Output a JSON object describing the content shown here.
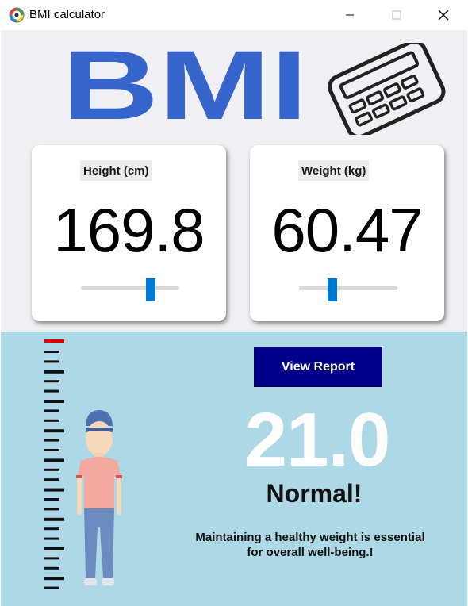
{
  "window": {
    "title": "BMI calculator"
  },
  "logo": {
    "text": "BMI",
    "color": "#3564cb"
  },
  "height_card": {
    "label": "Height (cm)",
    "value": "169.8",
    "slider_fraction": 0.73
  },
  "weight_card": {
    "label": "Weight (kg)",
    "value": "60.47",
    "slider_fraction": 0.32
  },
  "result": {
    "button_label": "View Report",
    "bmi": "21.0",
    "status": "Normal!",
    "message_line1": "Maintaining a healthy weight is essential",
    "message_line2": "for overall well-being.!"
  },
  "colors": {
    "top_background": "#eff0f3",
    "bottom_background": "#add8e6",
    "accent": "#0078d4",
    "button": "#00008b",
    "ruler_marker": "#e00000"
  },
  "icons": [
    "bmi-app-icon",
    "minimize-icon",
    "maximize-icon",
    "close-icon",
    "calculator-icon",
    "ruler-icon",
    "person-illustration"
  ]
}
